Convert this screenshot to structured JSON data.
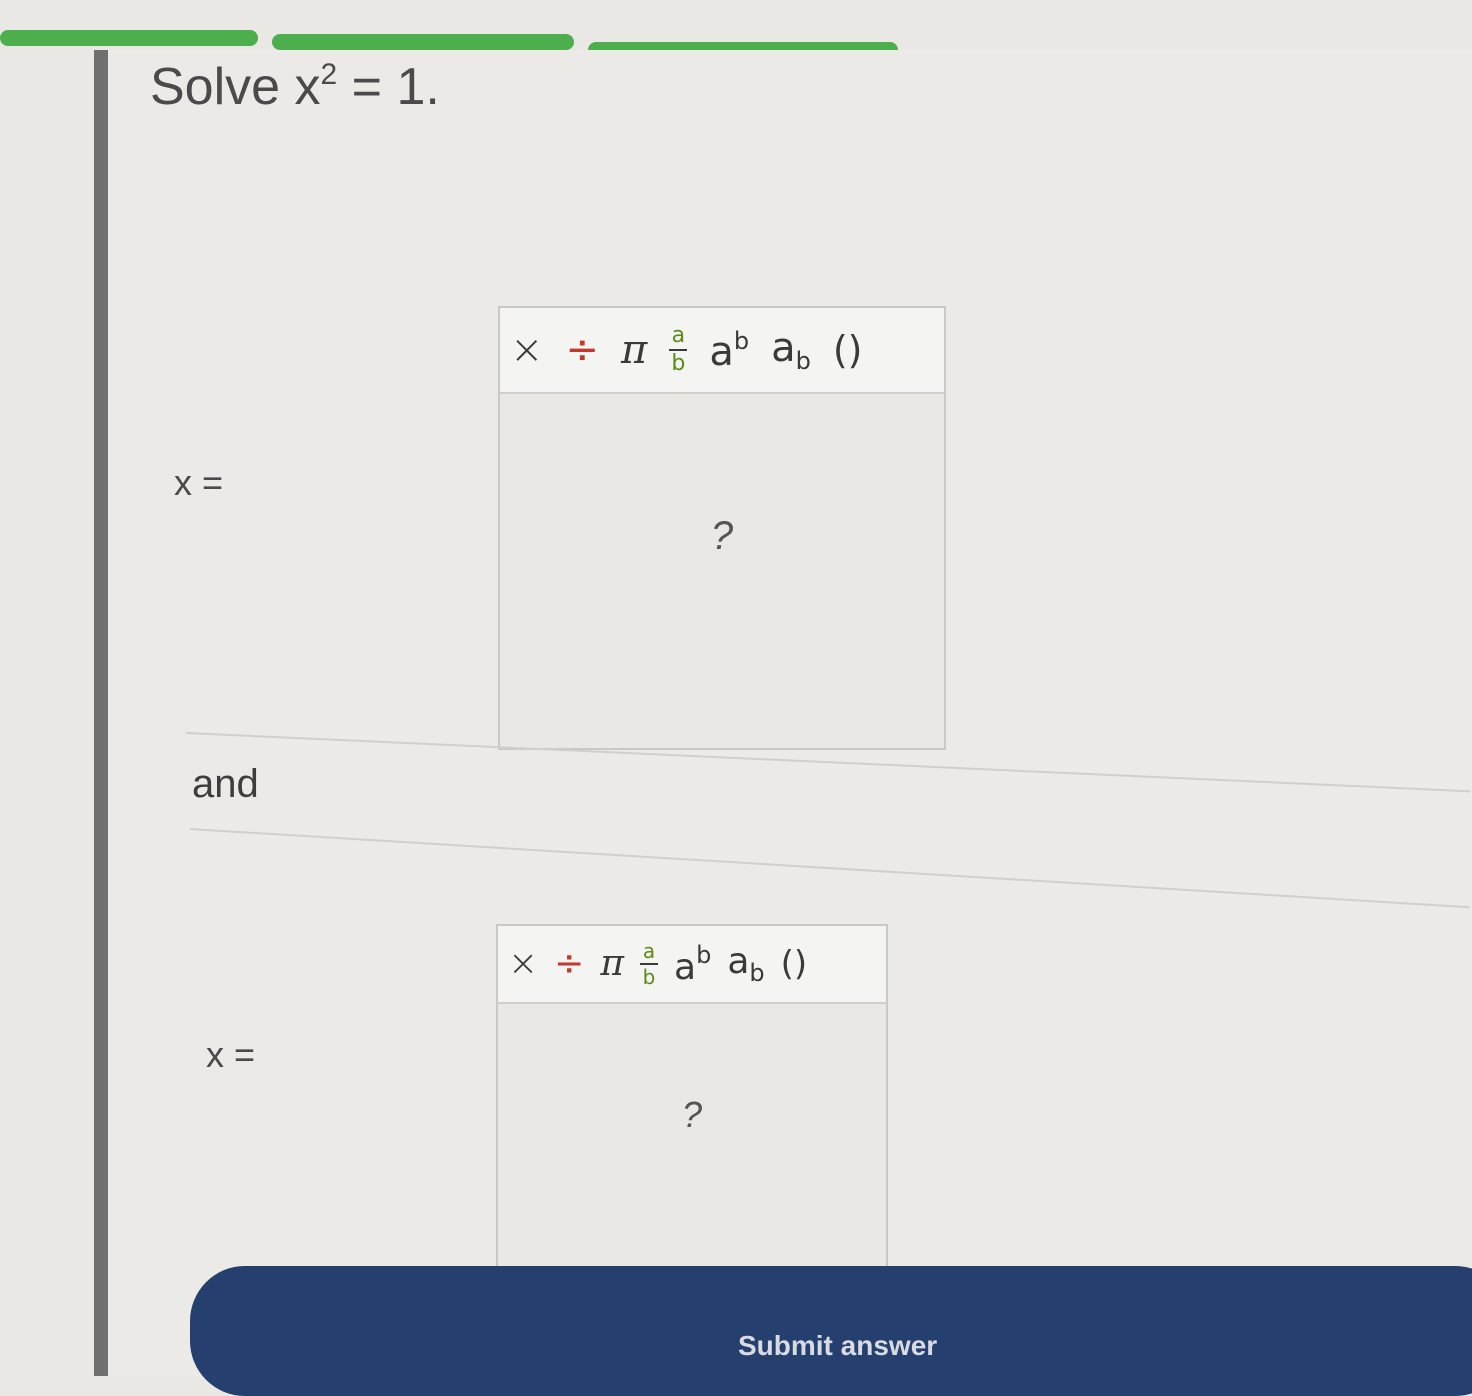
{
  "progress": {
    "segment_count": 5,
    "completed_segments": 5,
    "color": "#4cae4c"
  },
  "question": {
    "prefix": "Solve",
    "variable": "x",
    "exponent": "2",
    "equation_rest": "= 1."
  },
  "answers": [
    {
      "label": "x =",
      "placeholder": "?",
      "toolbar": {
        "times": "×",
        "divide": "÷",
        "pi": "π",
        "frac_num": "a",
        "frac_den": "b",
        "pow_base": "a",
        "pow_exp": "b",
        "sub_base": "a",
        "sub_idx": "b",
        "parens": "()"
      }
    },
    {
      "label": "x =",
      "placeholder": "?",
      "toolbar": {
        "times": "×",
        "divide": "÷",
        "pi": "π",
        "frac_num": "a",
        "frac_den": "b",
        "pow_base": "a",
        "pow_exp": "b",
        "sub_base": "a",
        "sub_idx": "b",
        "parens": "()"
      }
    }
  ],
  "separator_word": "and",
  "submit_label": "Submit answer",
  "colors": {
    "submit_bg": "#253f6e",
    "progress": "#4cae4c",
    "divide_symbol": "#c0392b",
    "fraction_letters": "#5a8a1a"
  }
}
